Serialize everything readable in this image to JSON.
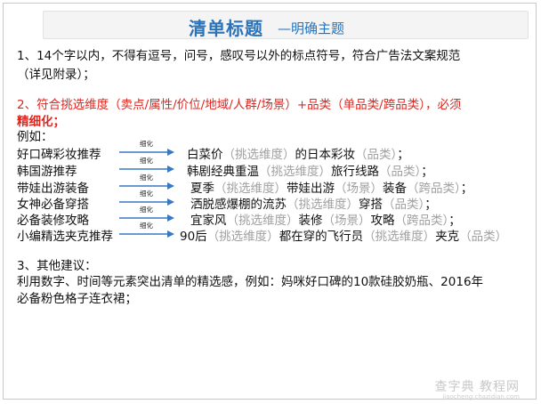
{
  "title": {
    "main": "清单标题",
    "sub": "—明确主题"
  },
  "rule1": {
    "line1": "1、14个字以内，不得有逗号，问号，感叹号以外的标点符号，符合广告法文案规范",
    "line2": "（详见附录）；"
  },
  "rule2": {
    "line1": "2、符合挑选维度（卖点/属性/价位/地域/人群/场景）+品类（单品类/跨品类），必须",
    "line2": "精细化；"
  },
  "example_label": "例如：",
  "arrow_label": "细化",
  "examples": [
    {
      "title": "好口碑彩妆推荐",
      "parts": [
        {
          "t": "白菜价",
          "g": false
        },
        {
          "t": "（挑选维度）",
          "g": true
        },
        {
          "t": "的日本彩妆",
          "g": false
        },
        {
          "t": "（品类）",
          "g": true
        },
        {
          "t": "；",
          "g": false
        }
      ]
    },
    {
      "title": "韩国游推荐",
      "parts": [
        {
          "t": "韩剧经典重温",
          "g": false
        },
        {
          "t": "（挑选维度）",
          "g": true
        },
        {
          "t": "旅行线路",
          "g": false
        },
        {
          "t": "（品类）",
          "g": true
        },
        {
          "t": "；",
          "g": false
        }
      ]
    },
    {
      "title": "带娃出游装备",
      "parts": [
        {
          "t": "夏季",
          "g": false
        },
        {
          "t": "（挑选维度）",
          "g": true
        },
        {
          "t": "带娃出游",
          "g": false
        },
        {
          "t": "（场景）",
          "g": true
        },
        {
          "t": "装备",
          "g": false
        },
        {
          "t": "（跨品类）",
          "g": true
        },
        {
          "t": "；",
          "g": false
        }
      ]
    },
    {
      "title": "女神必备穿搭",
      "parts": [
        {
          "t": "洒脱感爆棚的流苏",
          "g": false
        },
        {
          "t": "（挑选维度）",
          "g": true
        },
        {
          "t": "穿搭",
          "g": false
        },
        {
          "t": "（品类）",
          "g": true
        },
        {
          "t": "；",
          "g": false
        }
      ]
    },
    {
      "title": "必备装修攻略",
      "parts": [
        {
          "t": "宜家风",
          "g": false
        },
        {
          "t": "（挑选维度）",
          "g": true
        },
        {
          "t": "装修",
          "g": false
        },
        {
          "t": "（场景）",
          "g": true
        },
        {
          "t": "攻略",
          "g": false
        },
        {
          "t": "（跨品类）",
          "g": true
        },
        {
          "t": "；",
          "g": false
        }
      ]
    },
    {
      "title": "小编精选夹克推荐",
      "parts": [
        {
          "t": "90后",
          "g": false
        },
        {
          "t": "（挑选维度）",
          "g": true
        },
        {
          "t": "都在穿的飞行员",
          "g": false
        },
        {
          "t": "（挑选维度）",
          "g": true
        },
        {
          "t": "夹克",
          "g": false
        },
        {
          "t": "（品类）",
          "g": true
        }
      ]
    }
  ],
  "rule3": {
    "heading": "3、其他建议：",
    "line1": "利用数字、时间等元素突出清单的精选感，例如：妈咪好口碑的10款硅胶奶瓶、2016年",
    "line2": "必备粉色格子连衣裙；"
  },
  "watermark": {
    "main": "查字典 教程网",
    "sub": "jiaocheng.chazidian.com"
  },
  "colors": {
    "accent_blue": "#2a73b8",
    "red": "#e0261f",
    "gray": "#a0a0a0"
  }
}
